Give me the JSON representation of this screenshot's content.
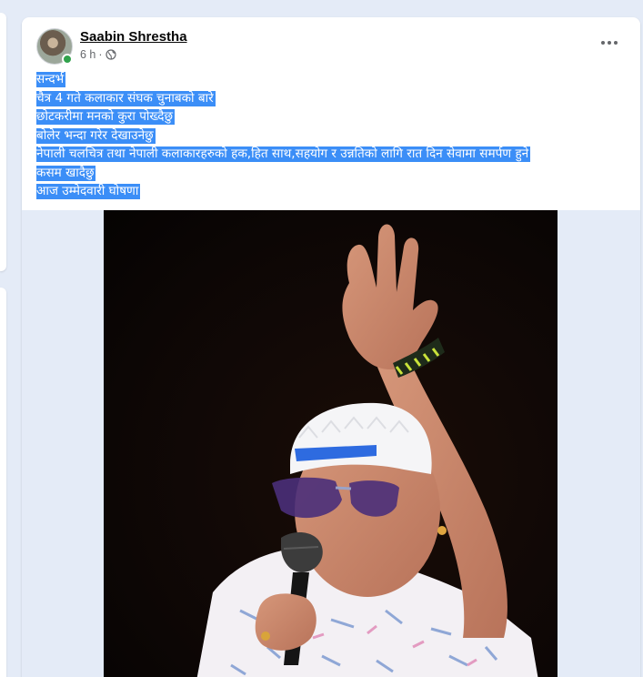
{
  "post": {
    "author": "Saabin Shrestha",
    "time": "6 h",
    "separator": "·",
    "audience_icon": "globe-icon",
    "more_icon": "more-options-icon",
    "text_lines": [
      "सन्दर्भ",
      "चैत्र 4 गते कलाकार संघक चुनाबको बारे",
      "छोटकरीमा मनको कुरा पोख्दैछु",
      "बोलेर  भन्दा गरेर देखाउनेछु",
      "नेपाली  चलचित्र तथा नेपाली कलाकारहरुको हक,हित साथ,सहयोग र उन्नतिको लागि रात दिन सेवामा समर्पण हुने",
      "कसम खादैछु",
      "आज उम्मेदवारी घोषणा"
    ]
  },
  "colors": {
    "page_background": "#e4ebf7",
    "selection_highlight": "#3b8ef7",
    "online_status": "#31a24c",
    "secondary_text": "#65676b"
  }
}
